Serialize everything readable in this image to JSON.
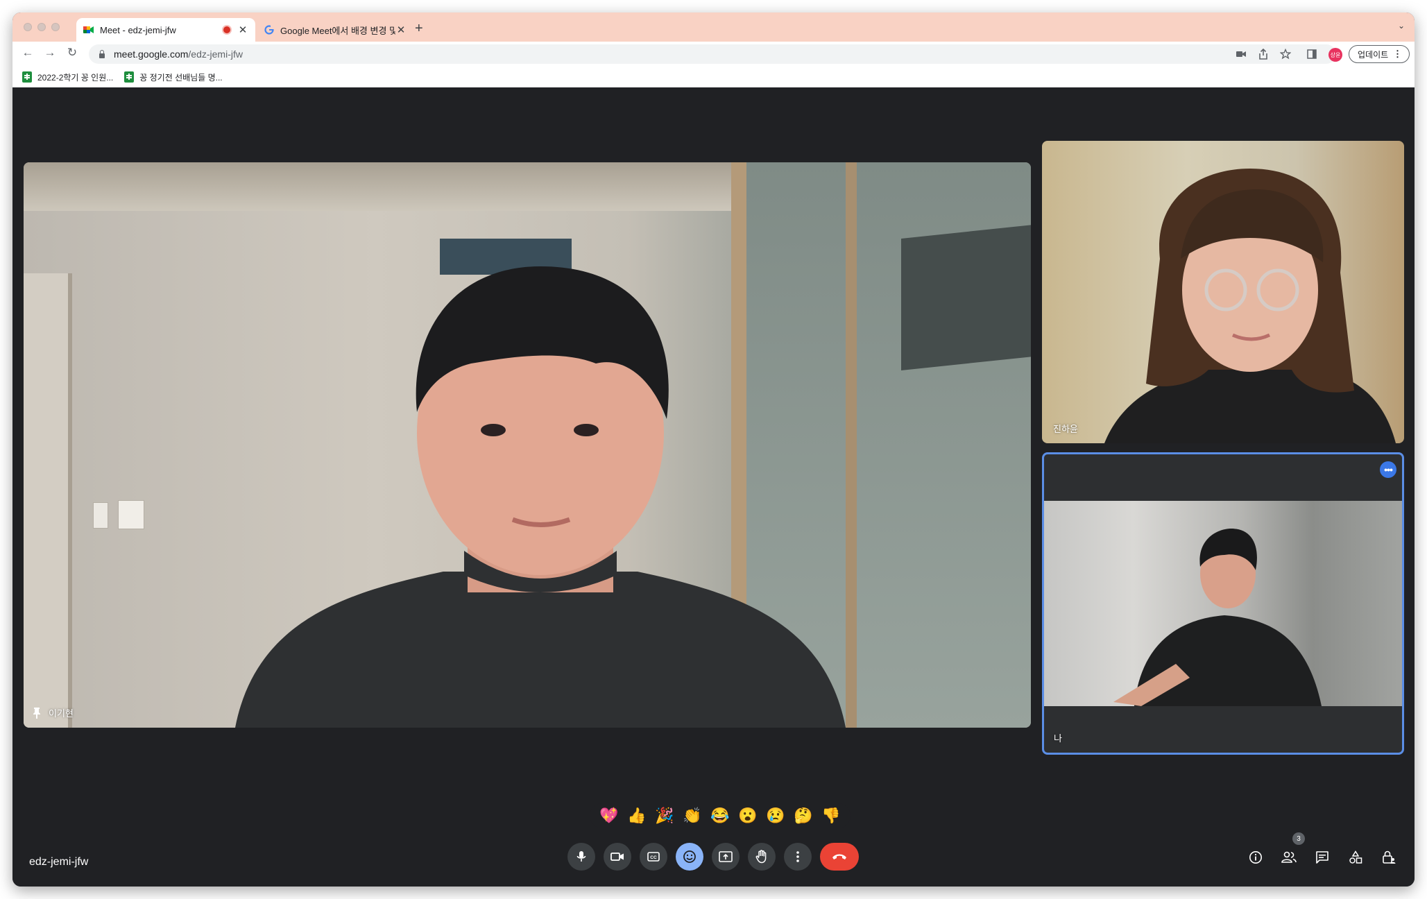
{
  "browser": {
    "tabs": [
      {
        "title": "Meet - edz-jemi-jfw",
        "active": true,
        "recording": true
      },
      {
        "title": "Google Meet에서 배경 변경 및 시",
        "active": false
      }
    ],
    "new_tab_symbol": "+",
    "address": {
      "host": "meet.google.com",
      "path": "/edz-jemi-jfw"
    },
    "profile_initials": "상윤",
    "update_button": "업데이트",
    "bookmarks": [
      {
        "label": "2022-2학기 꽁 인원...",
        "icon": "sheets-icon"
      },
      {
        "label": "꽁 정기전 선배님들 명...",
        "icon": "sheets-icon"
      }
    ]
  },
  "meet": {
    "meeting_code": "edz-jemi-jfw",
    "participants": {
      "main": {
        "name": "이기현",
        "pinned": true
      },
      "side": {
        "name": "진하윤"
      },
      "self": {
        "name": "나"
      }
    },
    "participant_count": "3",
    "reactions": [
      "💖",
      "👍",
      "🎉",
      "👏",
      "😂",
      "😮",
      "😢",
      "🤔",
      "👎"
    ],
    "controls": [
      "mic",
      "camera",
      "captions",
      "emoji",
      "present",
      "raise-hand",
      "more",
      "leave"
    ],
    "colors": {
      "accent": "#8ab4f8",
      "end_call": "#ea4335",
      "self_border": "#5b8ee6",
      "background": "#202124"
    }
  }
}
